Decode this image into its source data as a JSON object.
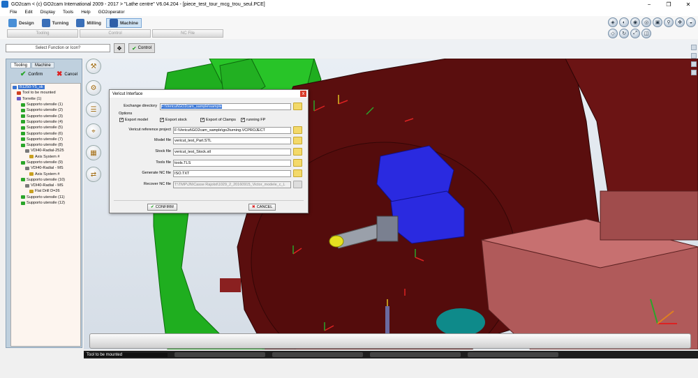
{
  "window": {
    "title": "GO2cam    < (c) GO2cam International 2009 - 2017 >   \"Lathe centre\"   V6.04.204 - [piece_test_tour_mcg_trou_seul.PCE]",
    "controls": [
      "−",
      "❐",
      "✕"
    ]
  },
  "menu": [
    "File",
    "Edit",
    "Display",
    "Tools",
    "Help",
    "GO2operator"
  ],
  "modes": [
    {
      "label": "Design",
      "color": "#4a8fd6"
    },
    {
      "label": "Turning",
      "color": "#3a6fb8"
    },
    {
      "label": "Milling",
      "color": "#3a6fb8"
    },
    {
      "label": "Machine",
      "color": "#2f5fa8"
    }
  ],
  "subtabs": [
    "Tooling",
    "Control",
    "NC File"
  ],
  "function_bar": {
    "placeholder": "Select Function or Icon?",
    "control_label": "Control"
  },
  "left_panel": {
    "tabs": [
      "Tooling",
      "Machine"
    ],
    "confirm": "Confirm",
    "cancel": "Cancel",
    "tree": [
      {
        "label": "B1250-Y5_sk",
        "indent": 0,
        "selected": true,
        "icon": "#3a74d1"
      },
      {
        "label": "Tool to be mounted",
        "indent": 1,
        "icon": "#d04020"
      },
      {
        "label": "Torrette (1)",
        "indent": 1,
        "icon": "#6a5bc8"
      },
      {
        "label": "Supporto utensile (1)",
        "indent": 2,
        "icon": "#2aa52a"
      },
      {
        "label": "Supporto utensile (2)",
        "indent": 2,
        "icon": "#2aa52a"
      },
      {
        "label": "Supporto utensile (3)",
        "indent": 2,
        "icon": "#2aa52a"
      },
      {
        "label": "Supporto utensile (4)",
        "indent": 2,
        "icon": "#2aa52a"
      },
      {
        "label": "Supporto utensile (5)",
        "indent": 2,
        "icon": "#2aa52a"
      },
      {
        "label": "Supporto utensile (6)",
        "indent": 2,
        "icon": "#2aa52a"
      },
      {
        "label": "Supporto utensile (7)",
        "indent": 2,
        "icon": "#2aa52a"
      },
      {
        "label": "Supporto utensile (8)",
        "indent": 2,
        "icon": "#2aa52a"
      },
      {
        "label": "VDI40-Radial-2525",
        "indent": 3,
        "icon": "#7a7a7a"
      },
      {
        "label": "Axis System #",
        "indent": 4,
        "icon": "#c8a020"
      },
      {
        "label": "Supporto utensile (9)",
        "indent": 2,
        "icon": "#2aa52a"
      },
      {
        "label": "VDI40-Radial - MS",
        "indent": 3,
        "icon": "#7a7a7a"
      },
      {
        "label": "Axis System #",
        "indent": 4,
        "icon": "#c8a020"
      },
      {
        "label": "Supporto utensile (10)",
        "indent": 2,
        "icon": "#2aa52a"
      },
      {
        "label": "VDI40-Radial - MS",
        "indent": 3,
        "icon": "#7a7a7a"
      },
      {
        "label": "Flat Drill D=26",
        "indent": 4,
        "icon": "#c8a020"
      },
      {
        "label": "Supporto utensile (11)",
        "indent": 2,
        "icon": "#2aa52a"
      },
      {
        "label": "Supporto utensile (12)",
        "indent": 2,
        "icon": "#2aa52a"
      }
    ]
  },
  "status": {
    "text": "Tool to be mounted"
  },
  "dialog": {
    "title": "Vericut Interface",
    "close": "x",
    "exchange_label": "Exchange directory",
    "exchange_value": "F:\\Vericut\\GO2cam_sample\\sample",
    "options_label": "Options",
    "checks": [
      {
        "label": "Export model",
        "checked": true
      },
      {
        "label": "Export stock",
        "checked": true
      },
      {
        "label": "Export of Clamps",
        "checked": true
      },
      {
        "label": "running FP",
        "checked": true
      }
    ],
    "fields": [
      {
        "label": "Vericut reference project",
        "value": "F:\\Vericut\\GO2cam_sample\\go2turning.VCPROJECT",
        "disabled": false
      },
      {
        "label": "Model file",
        "value": "vericut_test_Part.STL",
        "disabled": false
      },
      {
        "label": "Stock file",
        "value": "vericut_test_Stock.stl",
        "disabled": false
      },
      {
        "label": "Tools file",
        "value": "tools.TLS",
        "disabled": false
      },
      {
        "label": "Generate NC file",
        "value": "ISO.TXT",
        "disabled": false
      },
      {
        "label": "Recover NC file",
        "value": "T:\\TMP\\JN\\Casse Rajolst\\1029_2_20160915_Victor_modele_c_L",
        "disabled": true
      }
    ],
    "confirm": "CONFIRM",
    "cancel": "CANCEL"
  },
  "colors": {
    "machine_body": "#5a0e0e",
    "machine_frame": "#22b022",
    "tool_head": "#2a2ae0",
    "tailstock": "#b05a5a",
    "background": "#dde4ec"
  }
}
